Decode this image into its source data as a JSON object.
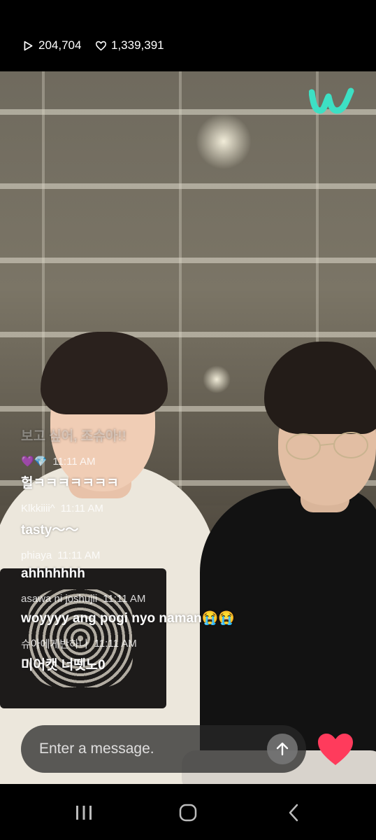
{
  "stats": {
    "views_icon": "play-icon",
    "views": "204,704",
    "likes_icon": "heart-outline-icon",
    "likes": "1,339,391"
  },
  "brand": {
    "logo_icon": "weverse-logo-icon",
    "accent_color": "#3de0c4"
  },
  "chat": {
    "messages": [
      {
        "user": "",
        "time": "",
        "text": "보고 싶어, 조슈아!!",
        "faded": true
      },
      {
        "user": "💜💎",
        "time": "11:11 AM",
        "text": "헐ㅋㅋㅋㅋㅋㅋㅋ"
      },
      {
        "user": "Klkkiiii^",
        "time": "11:11 AM",
        "text": "tasty～～"
      },
      {
        "user": "phiaya",
        "time": "11:11 AM",
        "text": "ahhhhhhh"
      },
      {
        "user": "asawa ni joshujii",
        "time": "11:11 AM",
        "text": "woyyyy ang pogi nyo naman😭😭"
      },
      {
        "user": "슈아에게반하나",
        "time": "11:11 AM",
        "text": "미어캣 너뗏노0"
      }
    ]
  },
  "composer": {
    "placeholder": "Enter a message.",
    "send_icon": "arrow-up-icon",
    "heart_icon": "heart-icon",
    "heart_color": "#ff3b5c"
  },
  "nav": {
    "recents_icon": "recents-icon",
    "home_icon": "home-icon",
    "back_icon": "back-icon"
  }
}
